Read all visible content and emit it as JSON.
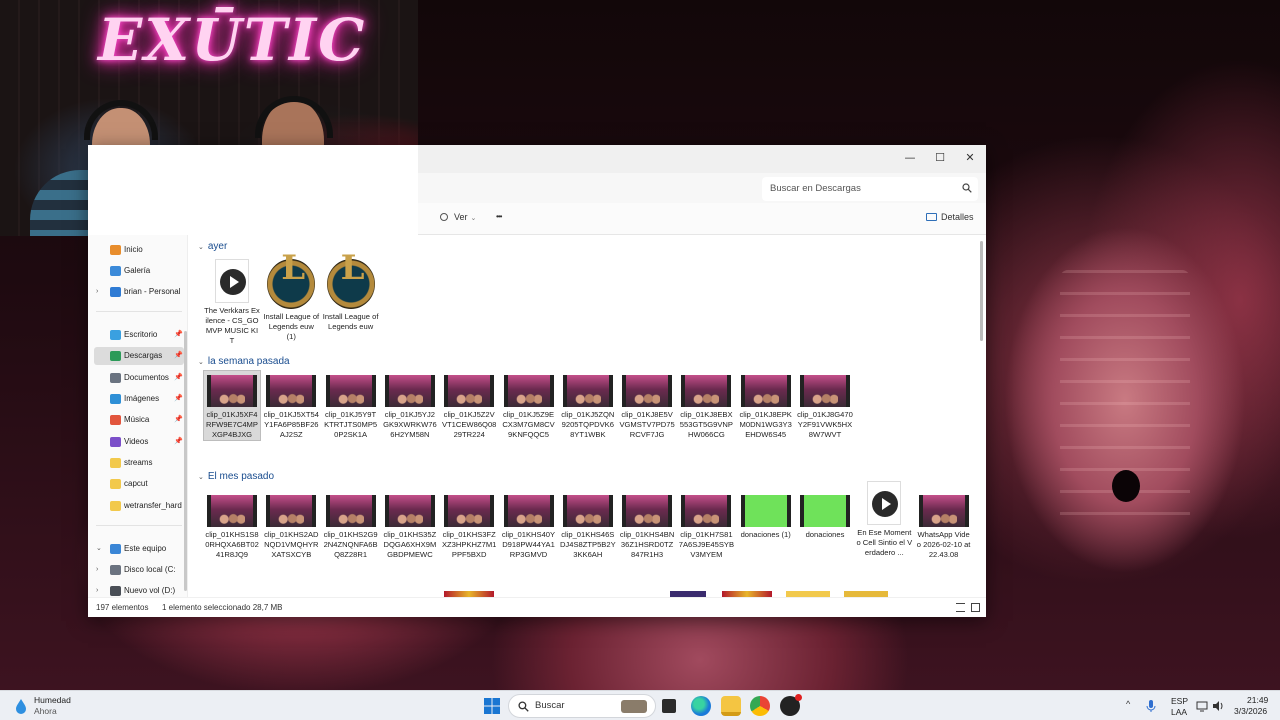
{
  "webcam": {
    "sign": "EXŪTIC"
  },
  "explorer": {
    "title_controls": {
      "minimize": "—",
      "maximize": "☐",
      "close": "✕"
    },
    "search": {
      "placeholder": "Buscar en Descargas"
    },
    "toolbar": {
      "view_label": "Ver",
      "more_label": "•••",
      "details_label": "Detalles"
    },
    "nav": {
      "items": [
        {
          "label": "Inicio",
          "icon": "home-icon",
          "color": "#e88d2c",
          "pinned": false,
          "chevron": ""
        },
        {
          "label": "Galería",
          "icon": "gallery-icon",
          "color": "#3b8ad9",
          "pinned": false,
          "chevron": ""
        },
        {
          "label": "brian - Personal",
          "icon": "onedrive-icon",
          "color": "#2f7bd4",
          "pinned": false,
          "chevron": "›"
        },
        {
          "label": "Escritorio",
          "icon": "desktop-icon",
          "color": "#3aa0e0",
          "pinned": true,
          "chevron": ""
        },
        {
          "label": "Descargas",
          "icon": "downloads-icon",
          "color": "#2b9a58",
          "pinned": true,
          "chevron": ""
        },
        {
          "label": "Documentos",
          "icon": "documents-icon",
          "color": "#6a7380",
          "pinned": true,
          "chevron": ""
        },
        {
          "label": "Imágenes",
          "icon": "pictures-icon",
          "color": "#2e8fd6",
          "pinned": true,
          "chevron": ""
        },
        {
          "label": "Música",
          "icon": "music-icon",
          "color": "#e2553d",
          "pinned": true,
          "chevron": ""
        },
        {
          "label": "Videos",
          "icon": "videos-icon",
          "color": "#7b4fc9",
          "pinned": true,
          "chevron": ""
        },
        {
          "label": "streams",
          "icon": "folder-icon",
          "color": "#f2c94c",
          "pinned": false,
          "chevron": ""
        },
        {
          "label": "capcut",
          "icon": "folder-icon",
          "color": "#f2c94c",
          "pinned": false,
          "chevron": ""
        },
        {
          "label": "wetransfer_hard",
          "icon": "folder-icon",
          "color": "#f2c94c",
          "pinned": false,
          "chevron": ""
        },
        {
          "label": "Este equipo",
          "icon": "pc-icon",
          "color": "#3a86d6",
          "pinned": false,
          "chevron": "⌄"
        },
        {
          "label": "Disco local (C:",
          "icon": "drive-icon",
          "color": "#6b7380",
          "pinned": false,
          "chevron": "›"
        },
        {
          "label": "Nuevo vol (D:)",
          "icon": "drive-icon",
          "color": "#4a4f57",
          "pinned": false,
          "chevron": "›"
        }
      ],
      "pin_glyph": "📌"
    },
    "groups": [
      {
        "label": "ayer",
        "files": [
          {
            "name": "The Verkkars Exilence - CS_GO MVP MUSIC KIT",
            "kind": "media"
          },
          {
            "name": "Install League of Legends euw (1)",
            "kind": "lol"
          },
          {
            "name": "Install League of Legends euw",
            "kind": "lol"
          }
        ]
      },
      {
        "label": "la semana pasada",
        "files": [
          {
            "name": "clip_01KJ5XF4RFW9E7C4MPXGP4BJXG",
            "kind": "video",
            "selected": true
          },
          {
            "name": "clip_01KJ5XT54Y1FA6P85BF26AJ2SZ",
            "kind": "video"
          },
          {
            "name": "clip_01KJ5Y9TKTRTJTS0MP50P2SK1A",
            "kind": "video"
          },
          {
            "name": "clip_01KJ5YJ2GK9XWRKW766H2YM58N",
            "kind": "video"
          },
          {
            "name": "clip_01KJ5Z2VVT1CEW86Q0829TR224",
            "kind": "video"
          },
          {
            "name": "clip_01KJ5Z9ECX3M7GM8CV9KNFQQC5",
            "kind": "video"
          },
          {
            "name": "clip_01KJ5ZQN9205TQPDVK68YT1WBK",
            "kind": "video"
          },
          {
            "name": "clip_01KJ8E5VVGMSTV7PD75RCVF7JG",
            "kind": "video"
          },
          {
            "name": "clip_01KJ8EBX553GT5G9VNPHW066CG",
            "kind": "video"
          },
          {
            "name": "clip_01KJ8EPKM0DN1WG3Y3EHDW6S45",
            "kind": "video"
          },
          {
            "name": "clip_01KJ8G470Y2F91VWK5HX8W7WVT",
            "kind": "video"
          }
        ]
      },
      {
        "label": "El mes pasado",
        "files": [
          {
            "name": "clip_01KHS1S80RHQXA6BT0241R8JQ9",
            "kind": "video"
          },
          {
            "name": "clip_01KHS2ADNQD1VMQHYRXATSXCYB",
            "kind": "video"
          },
          {
            "name": "clip_01KHS2G92N4ZNQNFA6BQ8Z28R1",
            "kind": "video"
          },
          {
            "name": "clip_01KHS35ZDQGA6XHX9MGBDPMEWC",
            "kind": "video"
          },
          {
            "name": "clip_01KHS3FZXZ3HPKHZ7M1PPF5BXD",
            "kind": "video"
          },
          {
            "name": "clip_01KHS40YD918PW44YA1RP3GMVD",
            "kind": "video"
          },
          {
            "name": "clip_01KHS46SDJ4S8ZTP5B2Y3KK6AH",
            "kind": "video"
          },
          {
            "name": "clip_01KHS4BN36Z1HSRD0TZ847R1H3",
            "kind": "video"
          },
          {
            "name": "clip_01KH7S817A6SJ9E45SYBV3MYEM",
            "kind": "video"
          },
          {
            "name": "donaciones (1)",
            "kind": "green"
          },
          {
            "name": "donaciones",
            "kind": "green"
          },
          {
            "name": "En Ese Momento Cell Sintio el Verdadero ...",
            "kind": "media"
          },
          {
            "name": "WhatsApp Video 2026-02-10 at 22.43.08",
            "kind": "video"
          }
        ]
      }
    ],
    "status": {
      "count": "197 elementos",
      "selection": "1 elemento seleccionado  28,7 MB"
    }
  },
  "taskbar": {
    "weather_title": "Humedad",
    "weather_sub": "Ahora",
    "search_label": "Buscar",
    "lang_top": "ESP",
    "lang_bottom": "LAA",
    "time": "21:49",
    "date": "3/3/2026",
    "tray_chevron": "^"
  }
}
